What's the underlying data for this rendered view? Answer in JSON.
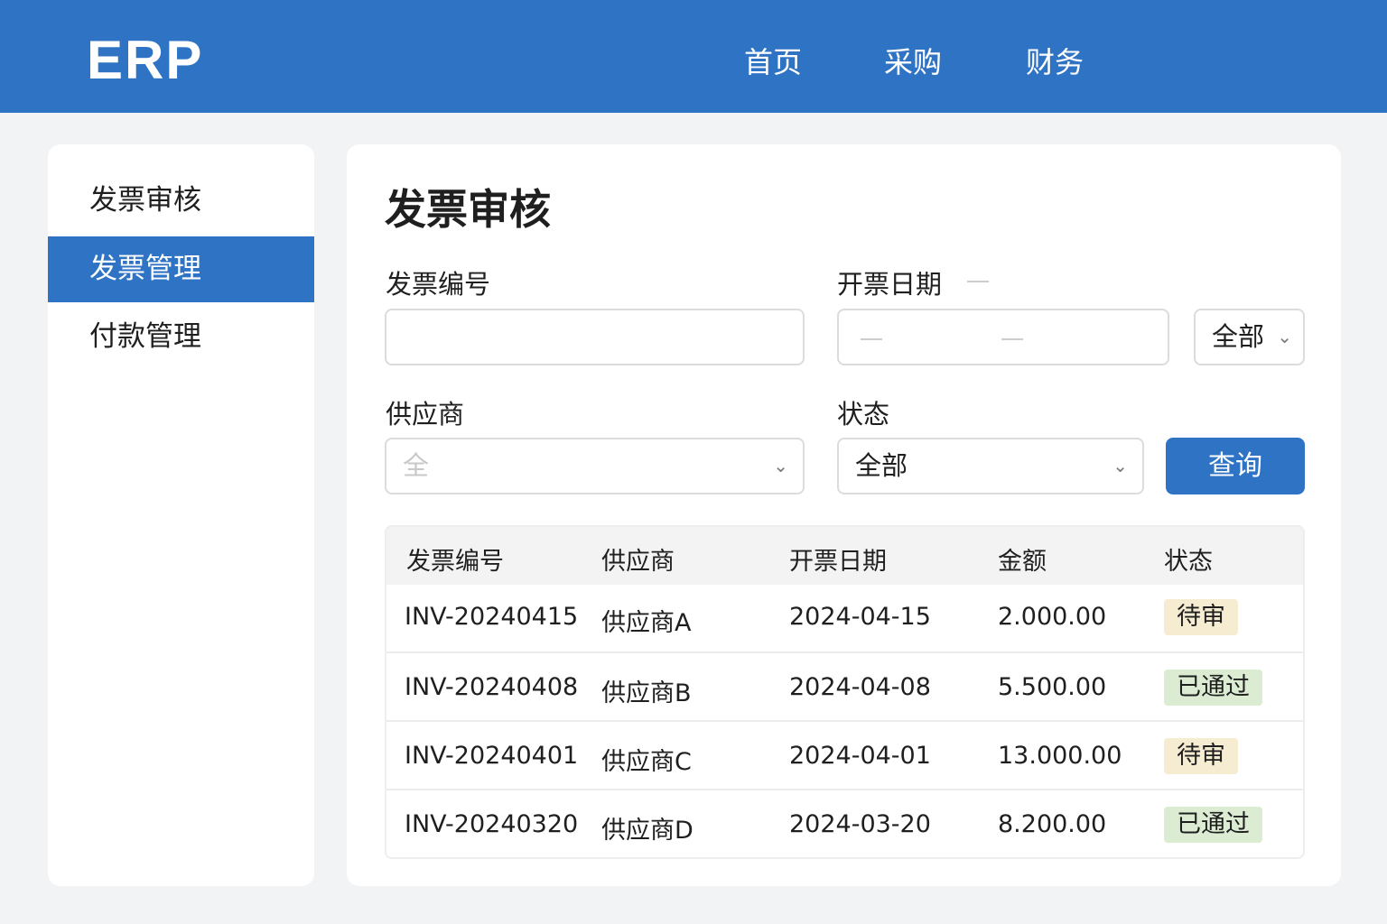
{
  "header": {
    "logo": "ERP",
    "nav": [
      "首页",
      "采购",
      "财务"
    ]
  },
  "sidebar": {
    "items": [
      {
        "label": "发票审核"
      },
      {
        "label": "发票管理"
      },
      {
        "label": "付款管理"
      }
    ]
  },
  "main": {
    "title": "发票审核",
    "filters": {
      "invoice_no_label": "发票编号",
      "invoice_no_value": "",
      "date_label": "开票日期",
      "date_scope": "全部",
      "supplier_label": "供应商",
      "supplier_placeholder": "全",
      "status_label": "状态",
      "status_value": "全部",
      "query_button": "查询"
    },
    "table": {
      "headers": [
        "发票编号",
        "供应商",
        "开票日期",
        "金额",
        "状态"
      ],
      "rows": [
        [
          "INV-20240415",
          "供应商A",
          "2024-04-15",
          "2.000.00",
          "待审"
        ],
        [
          "INV-20240408",
          "供应商B",
          "2024-04-08",
          "5.500.00",
          "已通过"
        ],
        [
          "INV-20240401",
          "供应商C",
          "2024-04-01",
          "13.000.00",
          "待审"
        ],
        [
          "INV-20240320",
          "供应商D",
          "2024-03-20",
          "8.200.00",
          "已通过"
        ]
      ]
    },
    "colors": {
      "pending_bg": "#f6ecd2",
      "approved_bg": "#dcecd3",
      "accent": "#2f74c4"
    }
  }
}
